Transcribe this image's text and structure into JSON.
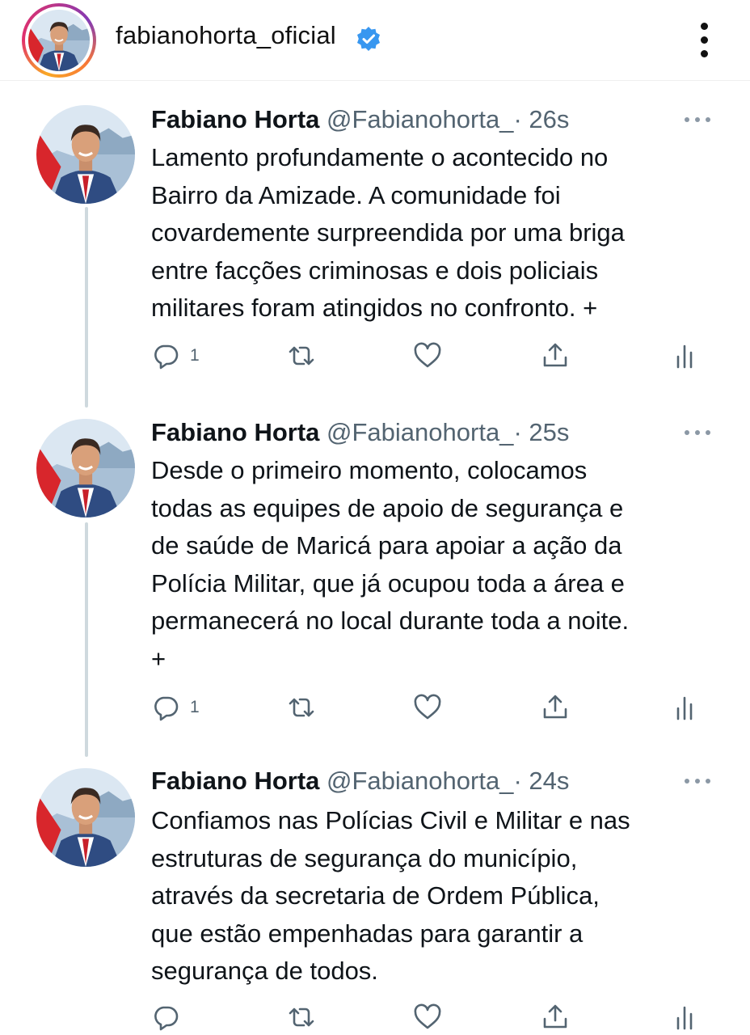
{
  "instagram": {
    "username": "fabianohorta_oficial",
    "verified_color": "#3897f0"
  },
  "tweets": [
    {
      "name": "Fabiano Horta",
      "handle": "@Fabianohorta_",
      "time": "· 26s",
      "text": "Lamento profundamente o acontecido no\nBairro da Amizade. A comunidade foi\ncovardemente surpreendida por uma briga\nentre facções criminosas e dois policiais\nmilitares foram atingidos no confronto. +",
      "reply_count": "1"
    },
    {
      "name": "Fabiano Horta",
      "handle": "@Fabianohorta_",
      "time": "· 25s",
      "text": "Desde o primeiro momento, colocamos\ntodas as equipes de apoio de segurança e\nde saúde de Maricá para apoiar a ação da\nPolícia Militar, que já ocupou toda a área e\npermanecerá no local durante toda a noite.\n+",
      "reply_count": "1"
    },
    {
      "name": "Fabiano Horta",
      "handle": "@Fabianohorta_",
      "time": "· 24s",
      "text": "Confiamos nas Polícias Civil e Militar e nas\nestruturas de segurança do município,\natravés da secretaria de Ordem Pública,\nque estão empenhadas para garantir a\nsegurança de todos.",
      "reply_count": ""
    }
  ],
  "icons": [
    "reply-icon",
    "retweet-icon",
    "like-icon",
    "share-icon",
    "analytics-icon"
  ],
  "colors": {
    "icon": "#536471",
    "thread_line": "#cfd9de",
    "text": "#0f1419"
  }
}
